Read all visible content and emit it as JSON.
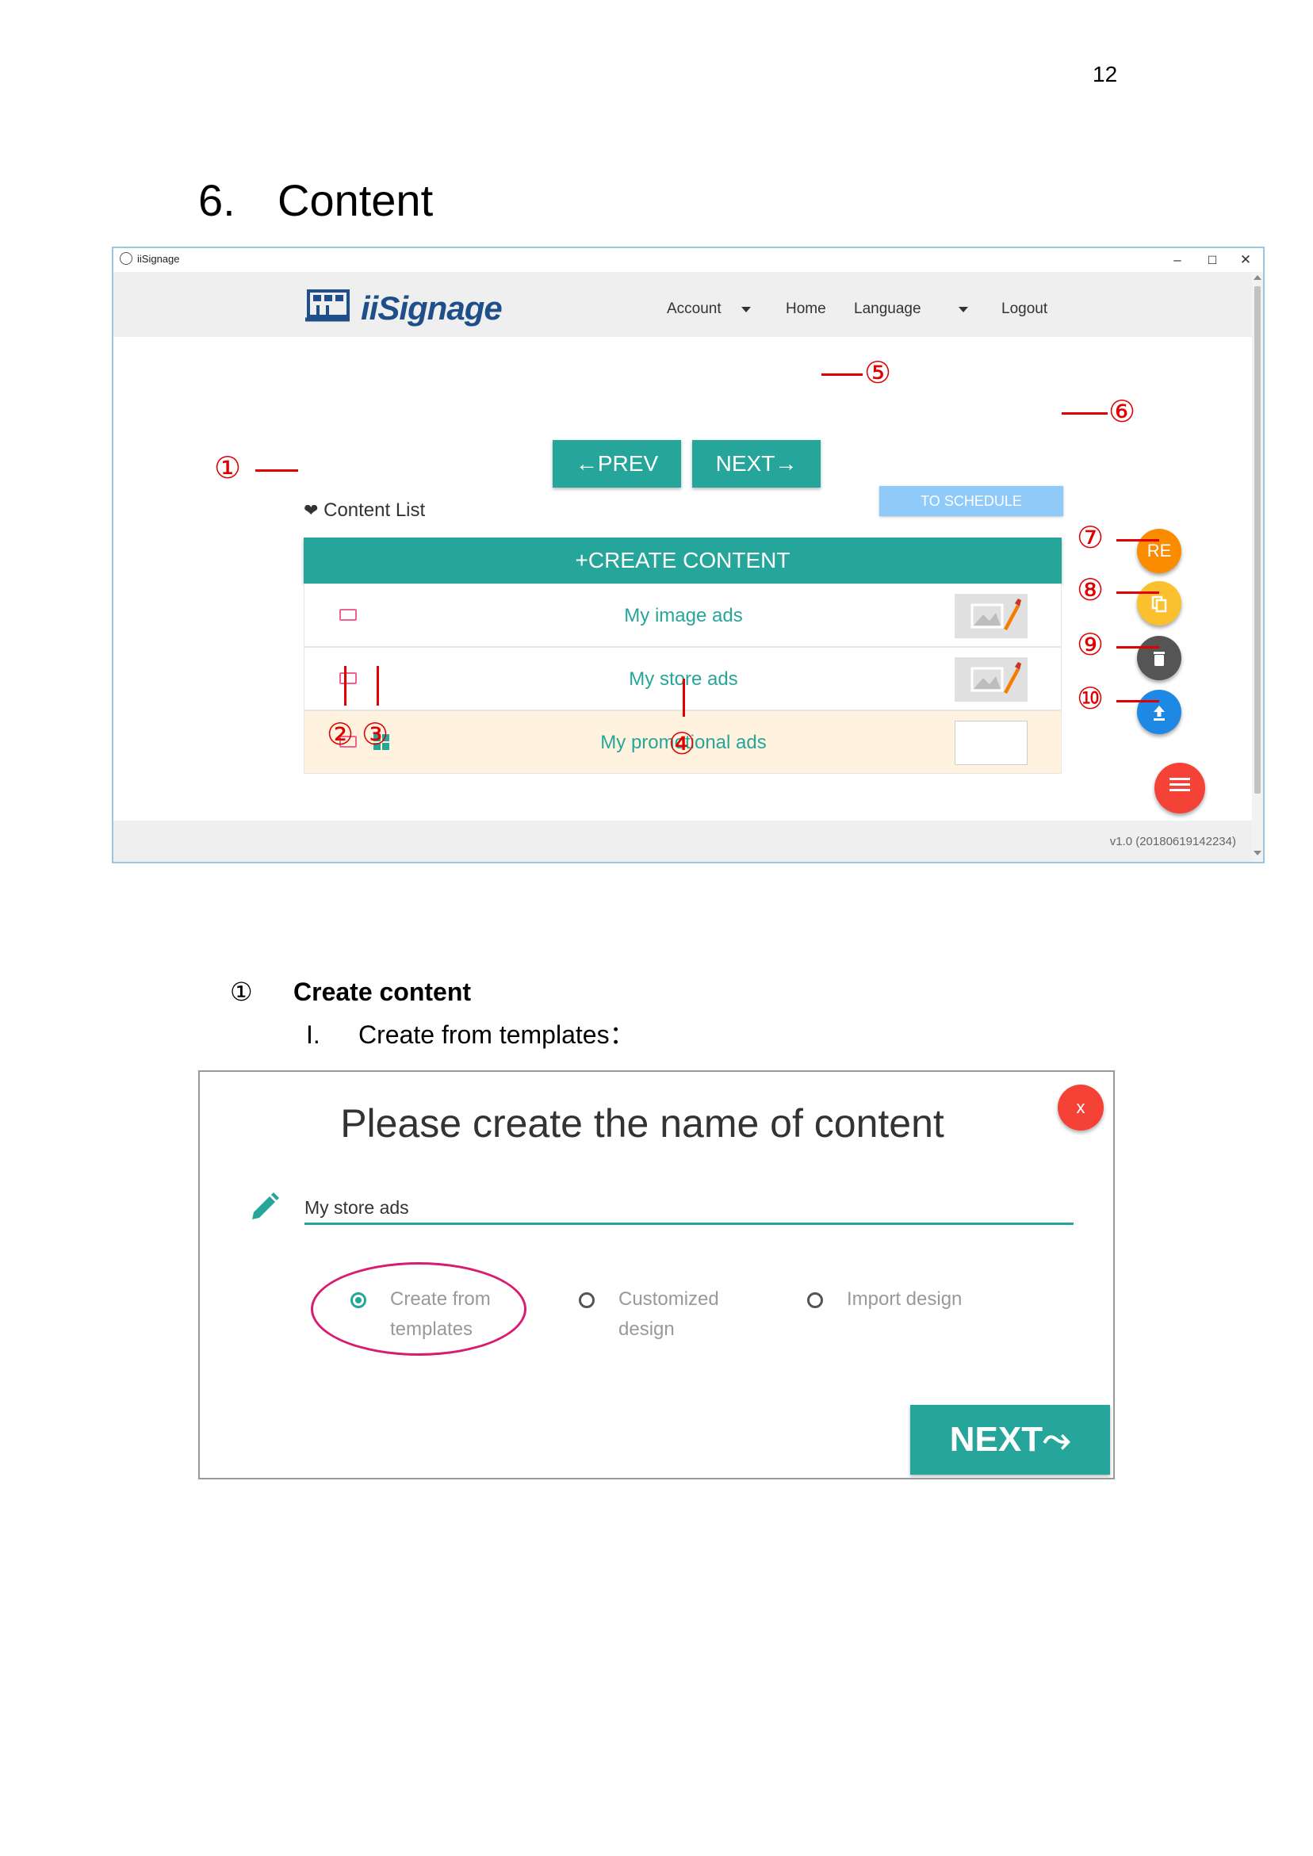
{
  "page": {
    "number": "12",
    "section_number": "6.",
    "section_title": "Content"
  },
  "window": {
    "title": "iiSignage",
    "controls": {
      "minimize": "–",
      "maximize": "☐",
      "close": "✕"
    }
  },
  "header": {
    "logo_text": "iiSignage",
    "nav": {
      "account": "Account",
      "home": "Home",
      "language": "Language",
      "logout": "Logout"
    }
  },
  "toolbar": {
    "prev_label": "←PREV",
    "next_label": "NEXT→",
    "schedule_label": "TO SCHEDULE"
  },
  "content_list": {
    "title": "Content List",
    "create_label": "+CREATE CONTENT",
    "rows": [
      {
        "title": "My image ads",
        "has_thumbnail": true,
        "highlighted": false
      },
      {
        "title": "My store ads",
        "has_thumbnail": true,
        "highlighted": false
      },
      {
        "title": "My promotional ads",
        "has_thumbnail": false,
        "highlighted": true
      }
    ]
  },
  "fabs": {
    "re_label": "RE",
    "colors": {
      "re": "#fb8c00",
      "copy": "#fbc02d",
      "delete": "#555555",
      "upload": "#1e88e5",
      "menu": "#f44336"
    }
  },
  "footer": {
    "version": "v1.0 (20180619142234)"
  },
  "annotations": {
    "c1": "①",
    "c2": "②",
    "c3": "③",
    "c4": "④",
    "c5": "⑤",
    "c6": "⑥",
    "c7": "⑦",
    "c8": "⑧",
    "c9": "⑨",
    "c10": "⑩"
  },
  "section": {
    "marker": "①",
    "heading": "Create content",
    "item_marker": "I.",
    "item_text": "Create from templates："
  },
  "dialog": {
    "title": "Please create the name of content",
    "close_label": "x",
    "name_value": "My store ads",
    "options": [
      {
        "line1": "Create from",
        "line2": "templates",
        "selected": true
      },
      {
        "line1": "Customized",
        "line2": "design",
        "selected": false
      },
      {
        "line1": "Import design",
        "line2": "",
        "selected": false
      }
    ],
    "next_label": "NEXT⤳"
  },
  "colors": {
    "accent": "#26a69a",
    "annotation": "#e00000",
    "highlight_ellipse": "#d81b73",
    "schedule": "#90caf9"
  }
}
